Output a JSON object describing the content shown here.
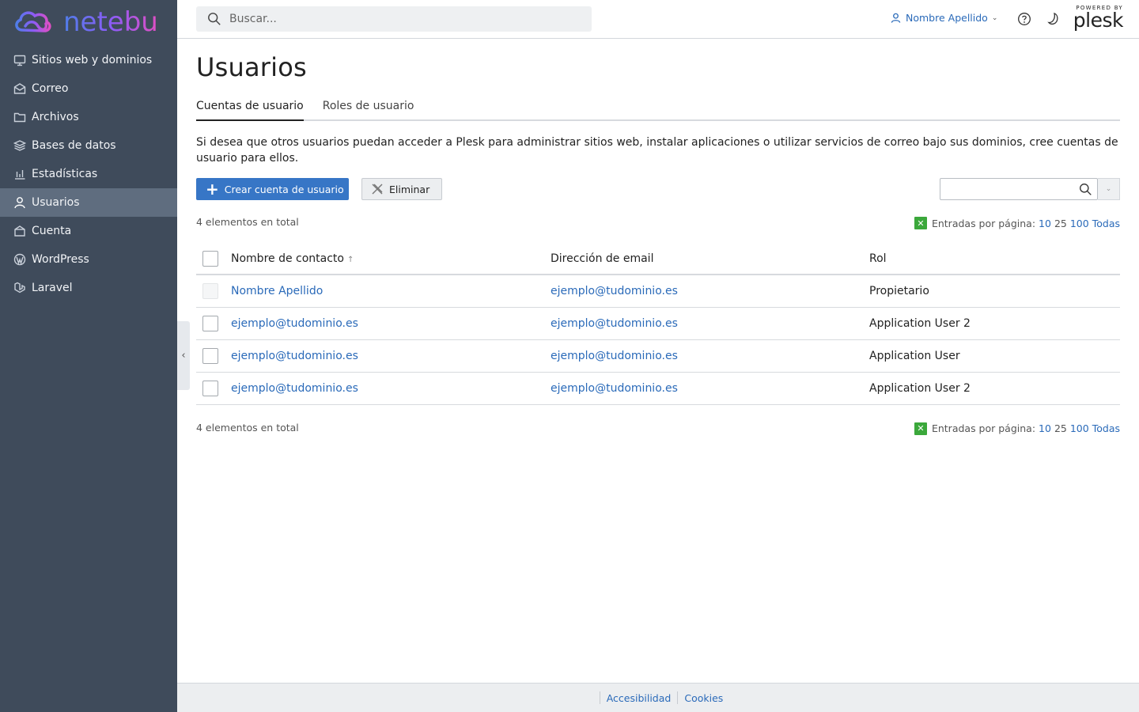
{
  "brand": {
    "name": "netebu",
    "powered_by": "POWERED BY",
    "plesk": "plesk"
  },
  "sidebar": {
    "items": [
      {
        "label": "Sitios web y dominios",
        "icon": "monitor-icon",
        "active": false
      },
      {
        "label": "Correo",
        "icon": "mail-icon",
        "active": false
      },
      {
        "label": "Archivos",
        "icon": "folder-icon",
        "active": false
      },
      {
        "label": "Bases de datos",
        "icon": "database-icon",
        "active": false
      },
      {
        "label": "Estadísticas",
        "icon": "bar-chart-icon",
        "active": false
      },
      {
        "label": "Usuarios",
        "icon": "user-icon",
        "active": true
      },
      {
        "label": "Cuenta",
        "icon": "account-icon",
        "active": false
      },
      {
        "label": "WordPress",
        "icon": "wordpress-icon",
        "active": false
      },
      {
        "label": "Laravel",
        "icon": "laravel-icon",
        "active": false
      }
    ]
  },
  "header": {
    "search_placeholder": "Buscar...",
    "user_name": "Nombre Apellido"
  },
  "page": {
    "title": "Usuarios",
    "tabs": [
      {
        "label": "Cuentas de usuario",
        "active": true
      },
      {
        "label": "Roles de usuario",
        "active": false
      }
    ],
    "description": "Si desea que otros usuarios puedan acceder a Plesk para administrar sitios web, instalar aplicaciones o utilizar servicios de correo bajo sus dominios, cree cuentas de usuario para ellos."
  },
  "toolbar": {
    "create_label": "Crear cuenta de usuario",
    "delete_label": "Eliminar"
  },
  "list_meta": {
    "total": "4 elementos en total",
    "per_page_label": "Entradas por página:",
    "per_page_options": [
      "10",
      "25",
      "100",
      "Todas"
    ],
    "current": "25"
  },
  "table": {
    "columns": [
      "Nombre de contacto",
      "Dirección de email",
      "Rol"
    ],
    "sort_indicator": "↑",
    "rows": [
      {
        "name": "Nombre Apellido",
        "email": "ejemplo@tudominio.es",
        "role": "Propietario",
        "checkbox_disabled": true
      },
      {
        "name": "ejemplo@tudominio.es",
        "email": "ejemplo@tudominio.es",
        "role": "Application User 2",
        "checkbox_disabled": false
      },
      {
        "name": "ejemplo@tudominio.es",
        "email": "ejemplo@tudominio.es",
        "role": "Application User",
        "checkbox_disabled": false
      },
      {
        "name": "ejemplo@tudominio.es",
        "email": "ejemplo@tudominio.es",
        "role": "Application User 2",
        "checkbox_disabled": false
      }
    ]
  },
  "footer": {
    "links": [
      "Accesibilidad",
      "Cookies"
    ]
  },
  "colors": {
    "sidebar_bg": "#3f4b5b",
    "sidebar_active": "#5f6d7f",
    "accent": "#3776c6",
    "link": "#2a6ab9"
  }
}
